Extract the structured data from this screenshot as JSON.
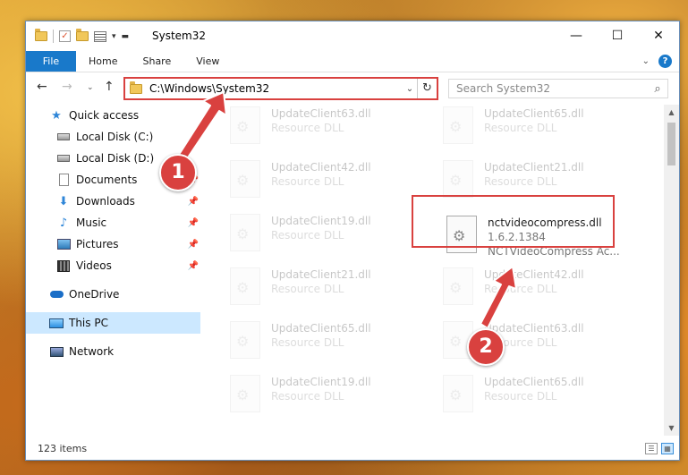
{
  "window": {
    "title": "System32"
  },
  "caption": {
    "minimize": "—",
    "maximize": "☐",
    "close": "✕"
  },
  "ribbon": {
    "tabs": [
      "File",
      "Home",
      "Share",
      "View"
    ]
  },
  "address": {
    "path": "C:\\Windows\\System32"
  },
  "search": {
    "placeholder": "Search System32"
  },
  "navpane": {
    "items": [
      {
        "label": "Quick access"
      },
      {
        "label": "Local Disk (C:)"
      },
      {
        "label": "Local Disk (D:)"
      },
      {
        "label": "Documents"
      },
      {
        "label": "Downloads"
      },
      {
        "label": "Music"
      },
      {
        "label": "Pictures"
      },
      {
        "label": "Videos"
      },
      {
        "label": "OneDrive"
      },
      {
        "label": "This PC"
      },
      {
        "label": "Network"
      }
    ]
  },
  "files": [
    {
      "name": "UpdateClient63.dll",
      "sub": "Resource DLL"
    },
    {
      "name": "UpdateClient65.dll",
      "sub": "Resource DLL"
    },
    {
      "name": "UpdateClient42.dll",
      "sub": "Resource DLL"
    },
    {
      "name": "UpdateClient21.dll",
      "sub": "Resource DLL"
    },
    {
      "name": "UpdateClient19.dll",
      "sub": "Resource DLL"
    },
    {
      "name": "nctvideocompress.dll",
      "sub": "1.6.2.1384",
      "sub2": "NCTVideoCompress Ac..."
    },
    {
      "name": "UpdateClient21.dll",
      "sub": "Resource DLL"
    },
    {
      "name": "UpdateClient42.dll",
      "sub": "Resource DLL"
    },
    {
      "name": "UpdateClient65.dll",
      "sub": "Resource DLL"
    },
    {
      "name": "UpdateClient63.dll",
      "sub": "Resource DLL"
    },
    {
      "name": "UpdateClient19.dll",
      "sub": "Resource DLL"
    },
    {
      "name": "UpdateClient65.dll",
      "sub": "Resource DLL"
    }
  ],
  "status": {
    "count": "123 items"
  },
  "annotations": {
    "step1": "1",
    "step2": "2",
    "color": "#d9413f"
  }
}
